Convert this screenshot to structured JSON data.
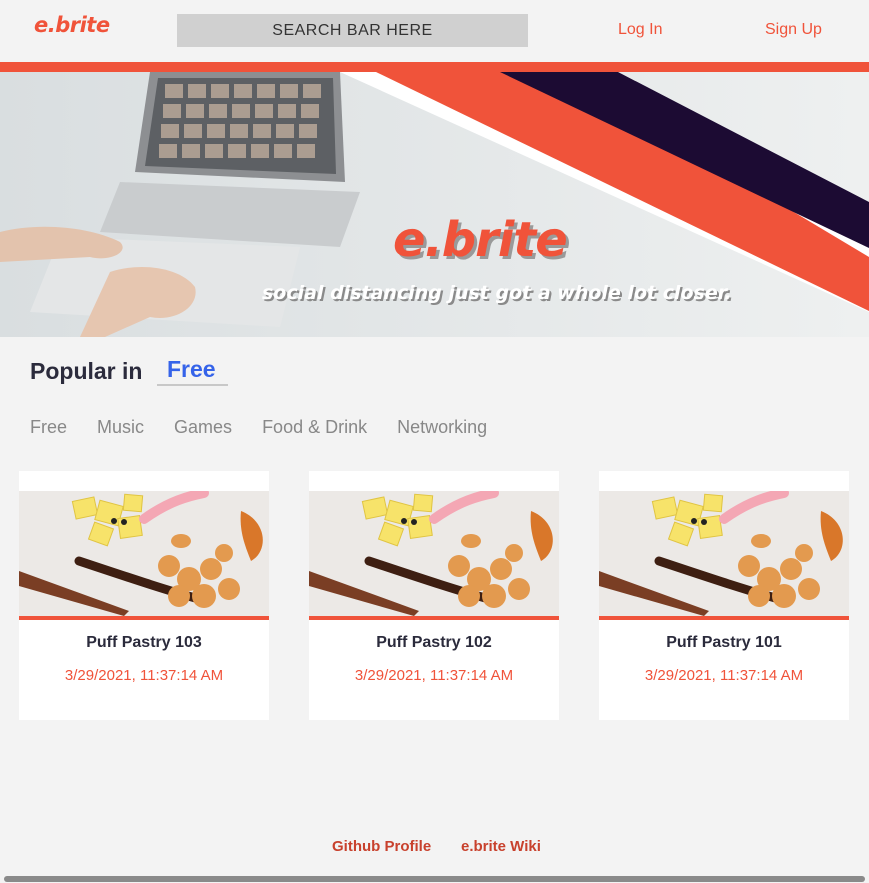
{
  "header": {
    "logo": "e.brite",
    "search_placeholder": "SEARCH BAR HERE",
    "login": "Log In",
    "signup": "Sign Up"
  },
  "hero": {
    "title": "e.brite",
    "tagline": "social distancing just got a whole lot closer."
  },
  "popular": {
    "label": "Popular in",
    "selected": "Free",
    "categories": [
      "Free",
      "Music",
      "Games",
      "Food & Drink",
      "Networking"
    ]
  },
  "events": [
    {
      "title": "Puff Pastry 103",
      "date": "3/29/2021, 11:37:14 AM"
    },
    {
      "title": "Puff Pastry 102",
      "date": "3/29/2021, 11:37:14 AM"
    },
    {
      "title": "Puff Pastry 101",
      "date": "3/29/2021, 11:37:14 AM"
    }
  ],
  "footer": {
    "github": "Github Profile",
    "wiki": "e.brite Wiki"
  },
  "colors": {
    "accent": "#f0533a",
    "navy": "#1c0b33",
    "link_blue": "#3563e9",
    "background": "#f3f3f3"
  }
}
